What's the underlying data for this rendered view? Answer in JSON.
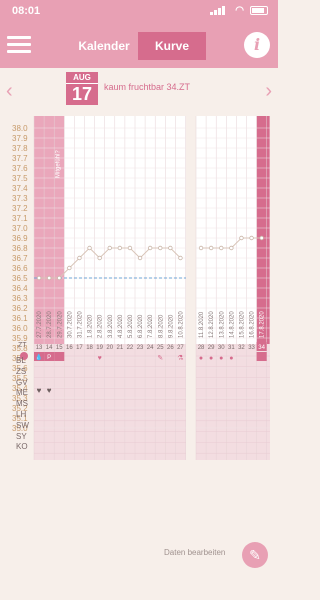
{
  "status": {
    "time": "08:01"
  },
  "nav": {
    "tabs": [
      {
        "label": "Kalender"
      },
      {
        "label": "Kurve"
      }
    ],
    "info_label": "i"
  },
  "date": {
    "month": "AUG",
    "day": "17",
    "status_text": "kaum fruchtbar  34.ZT"
  },
  "y_ticks": [
    "38.0",
    "37.9",
    "37.8",
    "37.7",
    "37.6",
    "37.5",
    "37.4",
    "37.3",
    "37.2",
    "37.1",
    "37.0",
    "36.9",
    "36.8",
    "36.7",
    "36.6",
    "36.5",
    "36.4",
    "36.3",
    "36.2",
    "36.1",
    "36.0",
    "35.9",
    "35.8",
    "35.7",
    "35.6",
    "35.5",
    "35.4",
    "35.3",
    "35.2",
    "35.1",
    "35.0"
  ],
  "cycle_day_label": "ZT",
  "left_days": [
    "13",
    "14",
    "15",
    "16",
    "17",
    "18",
    "19",
    "20",
    "21",
    "22",
    "23",
    "24",
    "25",
    "26",
    "27"
  ],
  "right_days": [
    "28",
    "29",
    "30",
    "31",
    "32",
    "33",
    "34"
  ],
  "left_dates": [
    "27.7.2020",
    "28.7.2020",
    "29.7.2020",
    "30.7.2020",
    "31.7.2020",
    "1.8.2020",
    "2.8.2020",
    "3.8.2020",
    "4.8.2020",
    "5.8.2020",
    "6.8.2020",
    "7.8.2020",
    "8.8.2020",
    "9.8.2020",
    "10.8.2020"
  ],
  "right_dates": [
    "11.8.2020",
    "12.8.2020",
    "13.8.2020",
    "14.8.2020",
    "15.8.2020",
    "16.8.2020",
    "17.8.2020"
  ],
  "special_label": "Mitgefühl?",
  "row_labels": [
    "BL",
    "ZS",
    "GV",
    "ME",
    "MS",
    "LH",
    "SW",
    "SY",
    "KO"
  ],
  "bottom": {
    "edit_label": "Daten bearbeiten"
  },
  "chart_data": {
    "type": "line",
    "left_x": [
      "27.7.2020",
      "28.7.2020",
      "29.7.2020",
      "30.7.2020",
      "31.7.2020",
      "1.8.2020",
      "2.8.2020",
      "3.8.2020",
      "4.8.2020",
      "5.8.2020",
      "6.8.2020",
      "7.8.2020",
      "8.8.2020",
      "9.8.2020",
      "10.8.2020"
    ],
    "left_y": [
      36.5,
      36.5,
      36.5,
      36.6,
      36.7,
      36.8,
      36.7,
      36.8,
      36.8,
      36.8,
      36.7,
      36.8,
      36.8,
      36.8,
      36.7
    ],
    "right_x": [
      "11.8.2020",
      "12.8.2020",
      "13.8.2020",
      "14.8.2020",
      "15.8.2020",
      "16.8.2020",
      "17.8.2020"
    ],
    "right_y": [
      36.8,
      36.8,
      36.8,
      36.8,
      36.9,
      36.9,
      36.9
    ],
    "coverline": 36.5,
    "ylim": [
      35.0,
      38.0
    ]
  }
}
